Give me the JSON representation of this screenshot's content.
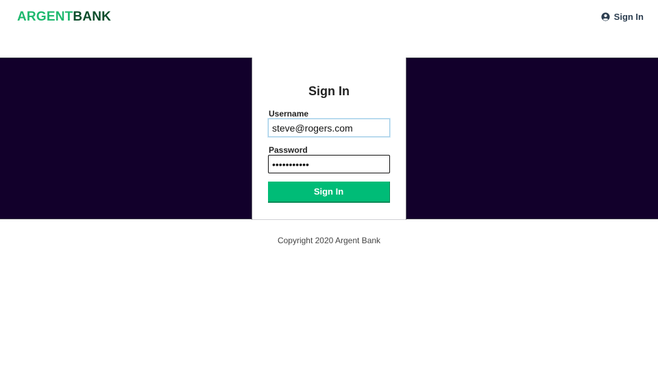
{
  "header": {
    "logo_part1": "ARGENT",
    "logo_part2": "BANK",
    "signin_label": "Sign In",
    "signin_icon": "user-circle-icon"
  },
  "login": {
    "title": "Sign In",
    "username_label": "Username",
    "username_value": "steve@rogers.com",
    "password_label": "Password",
    "password_value": "•••••••••••",
    "submit_label": "Sign In"
  },
  "footer": {
    "copyright": "Copyright 2020 Argent Bank"
  },
  "colors": {
    "brand_green": "#1fb96f",
    "brand_dark_green": "#0b4d2b",
    "button_green": "#00bc77",
    "hero_background": "#12002b"
  }
}
